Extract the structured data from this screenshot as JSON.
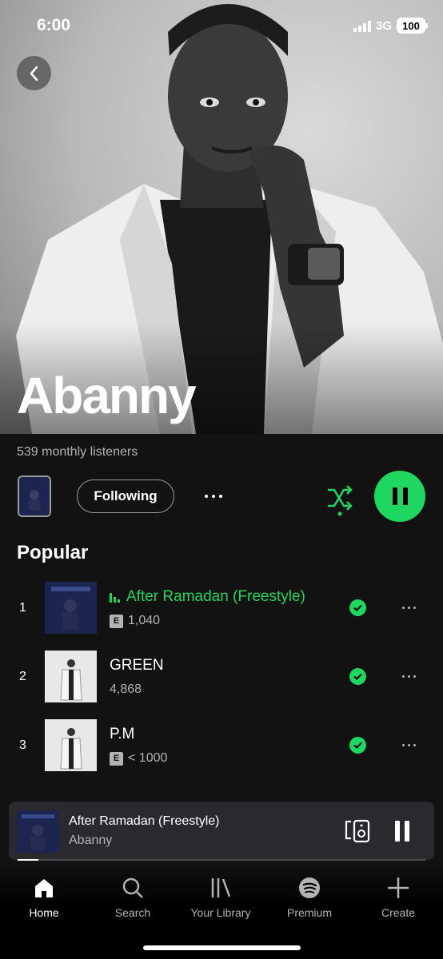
{
  "status_bar": {
    "time": "6:00",
    "network": "3G",
    "battery": "100"
  },
  "artist": {
    "name": "Abanny",
    "listeners": "539 monthly listeners"
  },
  "controls": {
    "follow_label": "Following"
  },
  "popular": {
    "title": "Popular",
    "tracks": [
      {
        "rank": "1",
        "title": "After Ramadan (Freestyle)",
        "plays": "1,040",
        "explicit": true,
        "playing": true,
        "art_color": "#1c2550"
      },
      {
        "rank": "2",
        "title": "GREEN",
        "plays": "4,868",
        "explicit": false,
        "playing": false,
        "art_color": "#e6e6e6"
      },
      {
        "rank": "3",
        "title": "P.M",
        "plays": "< 1000",
        "explicit": true,
        "playing": false,
        "art_color": "#e6e6e6"
      }
    ]
  },
  "now_playing": {
    "title": "After Ramadan (Freestyle)",
    "artist": "Abanny",
    "progress": 0.05
  },
  "nav": {
    "home": "Home",
    "search": "Search",
    "library": "Your Library",
    "premium": "Premium",
    "create": "Create"
  },
  "colors": {
    "accent": "#1ed760",
    "background": "#121212"
  },
  "icons": [
    "back-icon",
    "shuffle-icon",
    "pause-icon",
    "check-icon",
    "more-icon",
    "device-icon",
    "home-icon",
    "search-icon",
    "library-icon",
    "spotify-icon",
    "plus-icon",
    "explicit-badge"
  ]
}
